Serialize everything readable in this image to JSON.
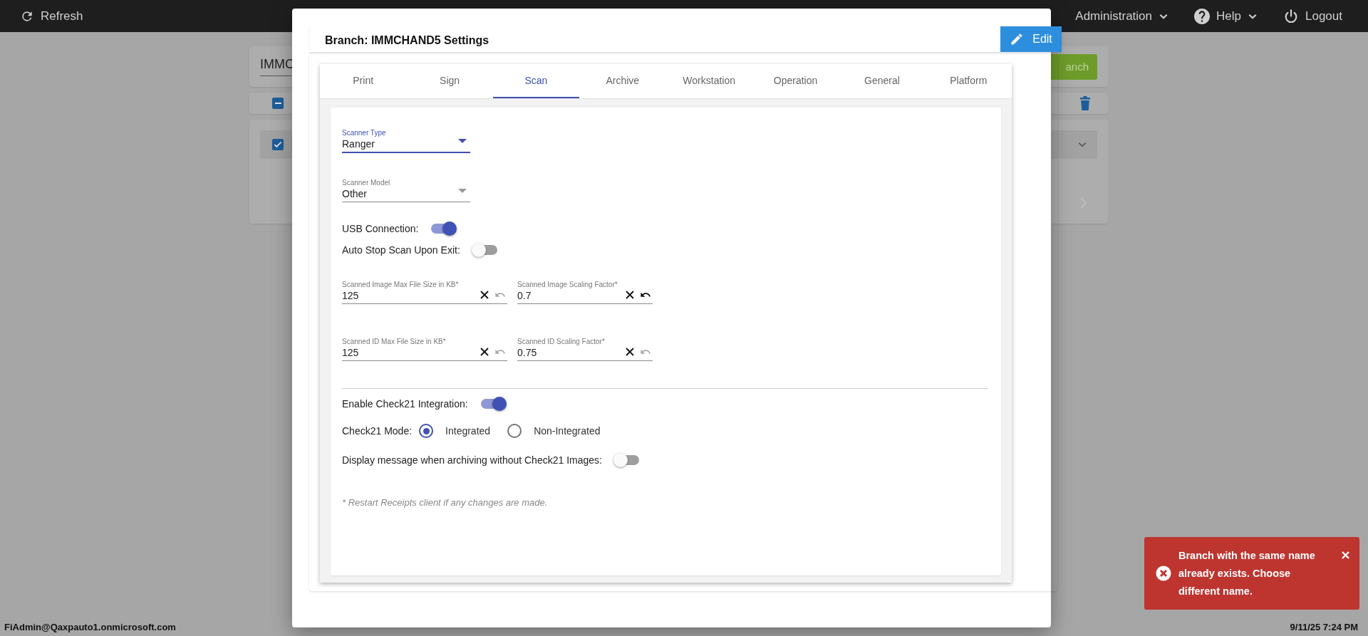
{
  "top_bar": {
    "refresh": "Refresh",
    "menus": [
      {
        "label": "Administration",
        "kind": "dropdown"
      },
      {
        "label": "Help",
        "kind": "help"
      },
      {
        "label": "Logout",
        "kind": "logout"
      }
    ]
  },
  "background": {
    "search_value": "IMMC",
    "add_button": "anch",
    "header_checkbox": {
      "indeterminate": true
    },
    "row_checkbox": {
      "checked": true
    }
  },
  "dialog": {
    "title": "Branch: IMMCHAND5 Settings",
    "edit_button": "Edit",
    "tabs": [
      {
        "label": "Print",
        "selected": false
      },
      {
        "label": "Sign",
        "selected": false
      },
      {
        "label": "Scan",
        "selected": true
      },
      {
        "label": "Archive",
        "selected": false
      },
      {
        "label": "Workstation",
        "selected": false
      },
      {
        "label": "Operation",
        "selected": false
      },
      {
        "label": "General",
        "selected": false
      },
      {
        "label": "Platform",
        "selected": false
      }
    ],
    "scanner_type": {
      "label": "Scanner Type",
      "value": "Ranger"
    },
    "scanner_model": {
      "label": "Scanner Model",
      "value": "Other"
    },
    "toggles": [
      {
        "label": "USB Connection:",
        "on": true
      },
      {
        "label": "Auto Stop Scan Upon Exit:",
        "on": false
      }
    ],
    "number_fields": [
      {
        "label": "Scanned Image Max File Size in KB*",
        "value": "125",
        "undo_enabled": false
      },
      {
        "label": "Scanned Image Scaling Factor*",
        "value": "0.7",
        "undo_enabled": true
      },
      {
        "label": "Scanned ID Max File Size in KB*",
        "value": "125",
        "undo_enabled": false
      },
      {
        "label": "Scanned ID Scaling Factor*",
        "value": "0.75",
        "undo_enabled": false
      }
    ],
    "check21_toggle": {
      "label": "Enable Check21 Integration:",
      "on": true
    },
    "check21_mode": {
      "label": "Check21 Mode:",
      "options": [
        {
          "label": "Integrated",
          "selected": true
        },
        {
          "label": "Non-Integrated",
          "selected": false
        }
      ]
    },
    "display_message_toggle": {
      "label": "Display message when archiving without Check21 Images:",
      "on": false
    },
    "note": "* Restart Receipts client if any changes are made."
  },
  "status_bar": {
    "user": "FiAdmin@Qaxpauto1.onmicrosoft.com",
    "datetime": "9/11/25 7:24 PM"
  },
  "toast": {
    "kind": "error",
    "message": "Branch with the same name already exists. Choose different name."
  }
}
